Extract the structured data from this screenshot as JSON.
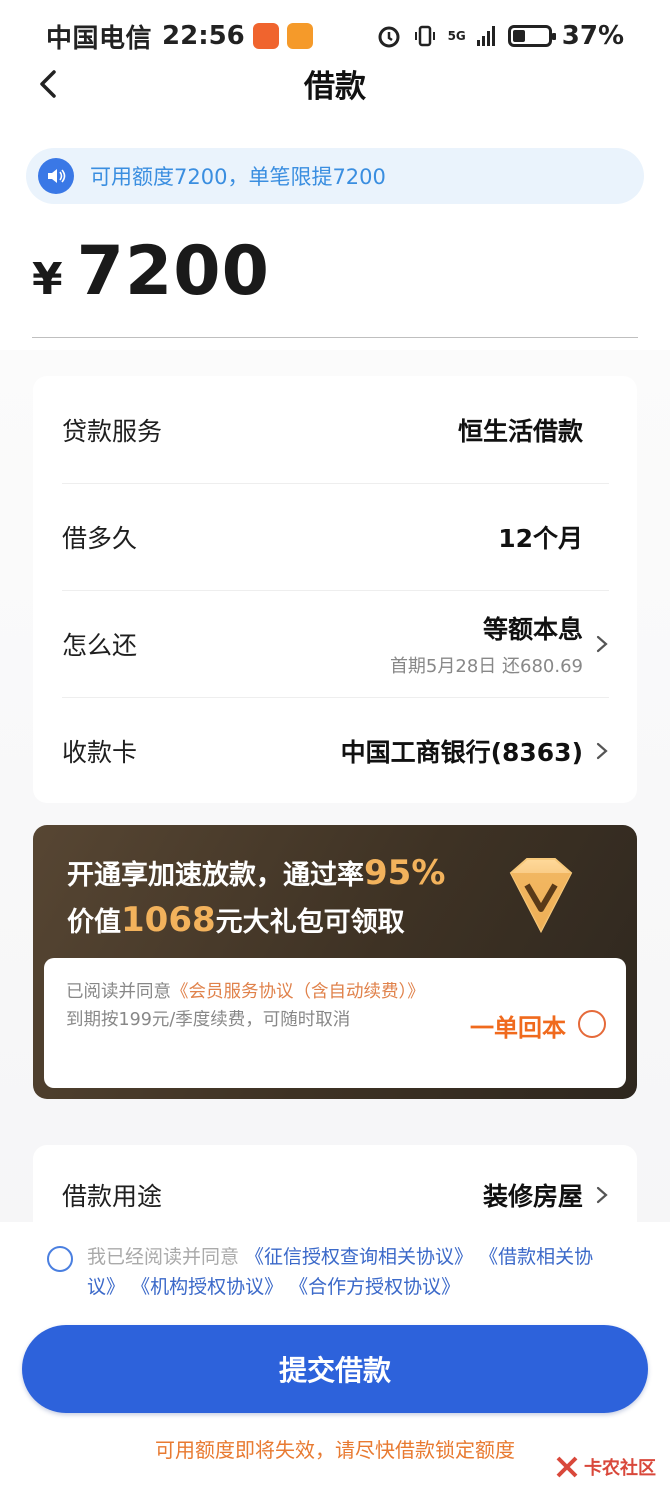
{
  "status_bar": {
    "carrier": "中国电信",
    "time": "22:56",
    "network": "5G",
    "battery_percent": "37%",
    "battery_level": 0.37
  },
  "nav": {
    "title": "借款"
  },
  "notice": {
    "text": "可用额度7200，单笔限提7200"
  },
  "amount": {
    "currency": "¥",
    "value": "7200"
  },
  "details": [
    {
      "label": "贷款服务",
      "value": "恒生活借款",
      "sub": ""
    },
    {
      "label": "借多久",
      "value": "12个月",
      "sub": ""
    },
    {
      "label": "怎么还",
      "value": "等额本息",
      "sub": "首期5月28日 还680.69"
    },
    {
      "label": "收款卡",
      "value": "中国工商银行(8363)",
      "sub": ""
    }
  ],
  "vip": {
    "line1_prefix": "开通享加速放款，通过率",
    "line1_highlight": "95%",
    "line2_prefix": "价值",
    "line2_highlight": "1068",
    "line2_suffix": "元大礼包可领取",
    "agree_prefix": "已阅读并同意",
    "agree_link": "《会员服务协议（含自动续费）》",
    "agree_suffix": " 到期按199元/季度续费，可随时取消",
    "cta": "一单回本"
  },
  "purpose": {
    "label": "借款用途",
    "value": "装修房屋"
  },
  "terms": {
    "prefix": "我已经阅读并同意 ",
    "link1": "《征信授权查询相关协议》",
    "link2": "《借款相关协议》",
    "link3": "《机构授权协议》",
    "link4": "《合作方授权协议》"
  },
  "submit_label": "提交借款",
  "warning": "可用额度即将失效，请尽快借款锁定额度",
  "watermark": "卡农社区",
  "colors": {
    "primary": "#2d62db",
    "notice_bg": "#eaf3fc",
    "notice_text": "#3a8ee0",
    "vip_gold": "#f2b25c",
    "orange": "#f06a1d"
  }
}
